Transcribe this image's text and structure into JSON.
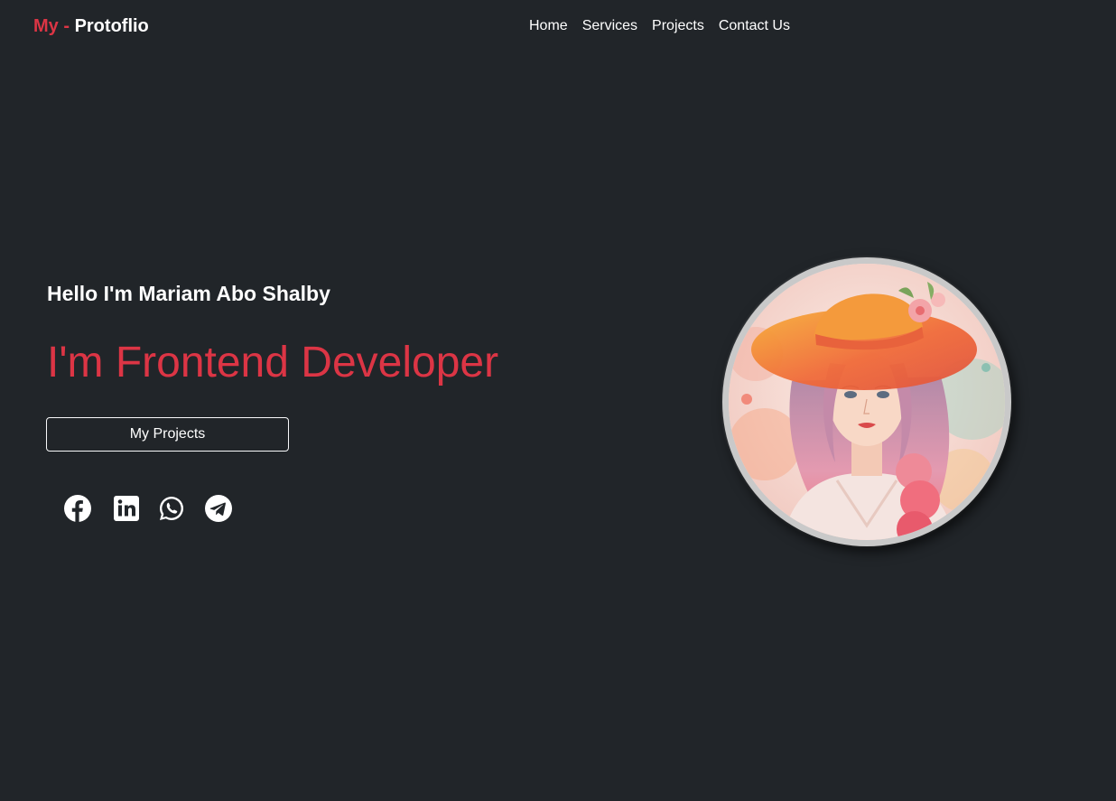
{
  "brand": {
    "accent": "My - ",
    "name": "Protoflio"
  },
  "nav": {
    "home": "Home",
    "services": "Services",
    "projects": "Projects",
    "contact": "Contact Us"
  },
  "hero": {
    "greeting": "Hello I'm Mariam Abo Shalby",
    "role": "I'm Frontend Developer",
    "cta": "My Projects"
  },
  "socials": [
    "facebook-icon",
    "linkedin-icon",
    "whatsapp-icon",
    "telegram-icon"
  ],
  "colors": {
    "accent": "#dc3545",
    "background": "#212529",
    "text": "#ffffff"
  }
}
